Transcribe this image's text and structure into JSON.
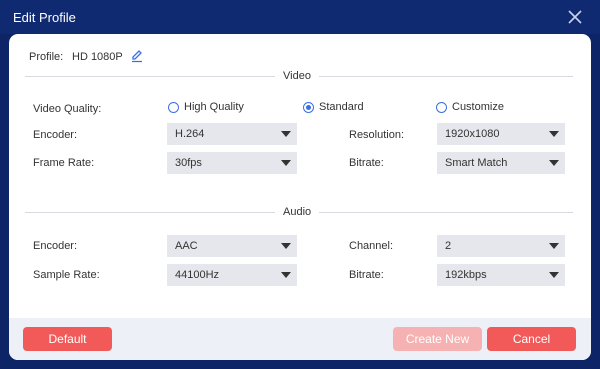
{
  "window": {
    "title": "Edit Profile"
  },
  "profile": {
    "label": "Profile:",
    "value": "HD 1080P"
  },
  "video": {
    "title": "Video",
    "quality_label": "Video Quality:",
    "quality_options": [
      "High Quality",
      "Standard",
      "Customize"
    ],
    "quality_selected": "Standard",
    "encoder_label": "Encoder:",
    "encoder_value": "H.264",
    "resolution_label": "Resolution:",
    "resolution_value": "1920x1080",
    "framerate_label": "Frame Rate:",
    "framerate_value": "30fps",
    "bitrate_label": "Bitrate:",
    "bitrate_value": "Smart Match"
  },
  "audio": {
    "title": "Audio",
    "encoder_label": "Encoder:",
    "encoder_value": "AAC",
    "channel_label": "Channel:",
    "channel_value": "2",
    "samplerate_label": "Sample Rate:",
    "samplerate_value": "44100Hz",
    "bitrate_label": "Bitrate:",
    "bitrate_value": "192kbps"
  },
  "buttons": {
    "default": "Default",
    "create_new": "Create New",
    "cancel": "Cancel"
  },
  "colors": {
    "accent": "#3a6fe3",
    "danger": "#f25a5a",
    "danger_disabled": "#f6b2b2",
    "titlebar": "#102a72"
  },
  "icons": {
    "close": "close-icon",
    "edit": "pencil-icon",
    "dropdown": "chevron-down-icon"
  }
}
